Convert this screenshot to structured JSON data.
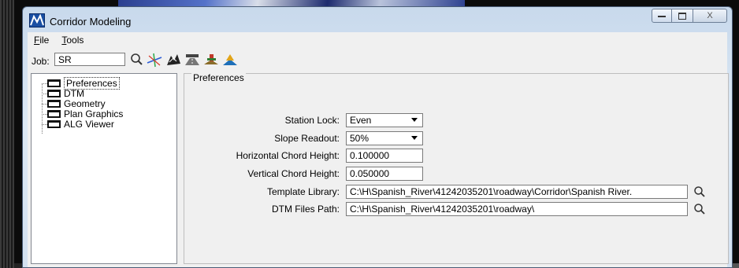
{
  "window": {
    "title": "Corridor Modeling",
    "close_glyph": "X"
  },
  "menu": [
    {
      "label": "File",
      "accel": "F",
      "rest": "ile"
    },
    {
      "label": "Tools",
      "accel": "T",
      "rest": "ools"
    }
  ],
  "toolbar": {
    "job_label": "Job:",
    "job_value": "SR",
    "icons": [
      "search-icon",
      "alignment-icon",
      "surface-icon",
      "roadway-designer-icon",
      "template-icon",
      "cross-section-icon"
    ]
  },
  "tree": {
    "items": [
      {
        "label": "Preferences",
        "selected": true
      },
      {
        "label": "DTM",
        "selected": false
      },
      {
        "label": "Geometry",
        "selected": false
      },
      {
        "label": "Plan Graphics",
        "selected": false
      },
      {
        "label": "ALG Viewer",
        "selected": false
      }
    ]
  },
  "preferences": {
    "title": "Preferences",
    "station_lock": {
      "label": "Station Lock:",
      "value": "Even"
    },
    "slope_readout": {
      "label": "Slope Readout:",
      "value": "50%"
    },
    "horizontal_chord_height": {
      "label": "Horizontal Chord Height:",
      "value": "0.100000"
    },
    "vertical_chord_height": {
      "label": "Vertical Chord Height:",
      "value": "0.050000"
    },
    "template_library": {
      "label": "Template Library:",
      "value": "C:\\H\\Spanish_River\\41242035201\\roadway\\Corridor\\Spanish River."
    },
    "dtm_files_path": {
      "label": "DTM Files Path:",
      "value": "C:\\H\\Spanish_River\\41242035201\\roadway\\"
    }
  }
}
